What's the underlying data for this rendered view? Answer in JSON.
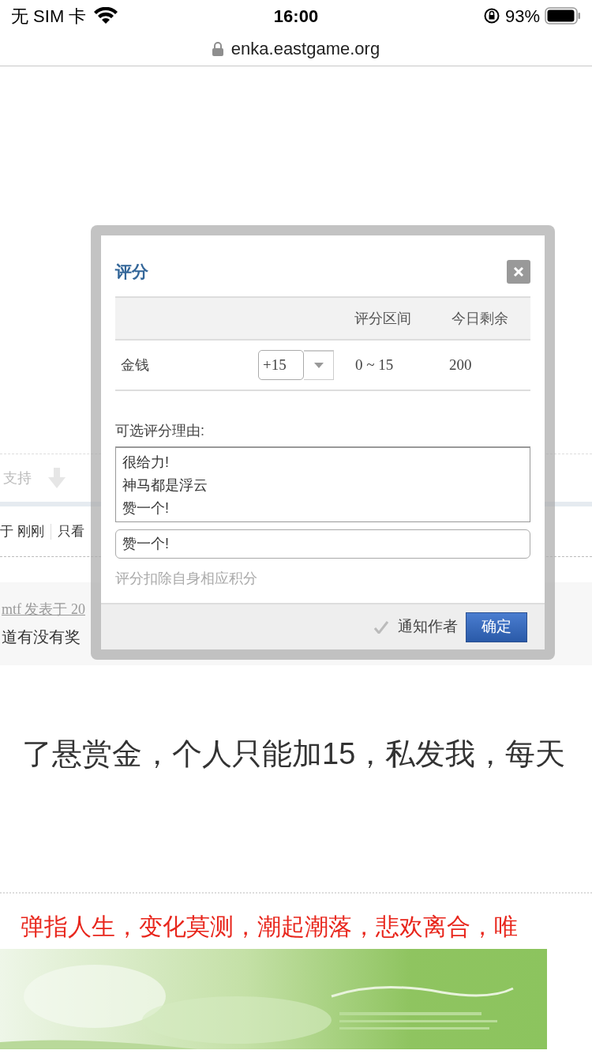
{
  "status_bar": {
    "carrier": "无 SIM 卡",
    "time": "16:00",
    "battery": "93%"
  },
  "address_bar": {
    "url": "enka.eastgame.org"
  },
  "page": {
    "vote_row": {
      "support": "支持"
    },
    "post_meta": {
      "posted": "于 刚刚",
      "only_view": "只看"
    },
    "quote": {
      "author_line": "mtf 发表于 20",
      "text": "道有没有奖"
    },
    "body_text": "了悬赏金，个人只能加15，私发我，每天",
    "signature": "弹指人生，变化莫测，潮起潮落，悲欢离合，唯"
  },
  "dialog": {
    "title": "评分",
    "columns": [
      "评分区间",
      "今日剩余"
    ],
    "rows": [
      {
        "label": "金钱",
        "value": "+15",
        "range": "0 ~ 15",
        "remaining": "200"
      }
    ],
    "reasons_label": "可选评分理由:",
    "reasons": [
      "很给力!",
      "神马都是浮云",
      "赞一个!"
    ],
    "reason_value": "赞一个!",
    "hint": "评分扣除自身相应积分",
    "notify": {
      "label": "通知作者",
      "checked": true
    },
    "confirm": "确定"
  }
}
